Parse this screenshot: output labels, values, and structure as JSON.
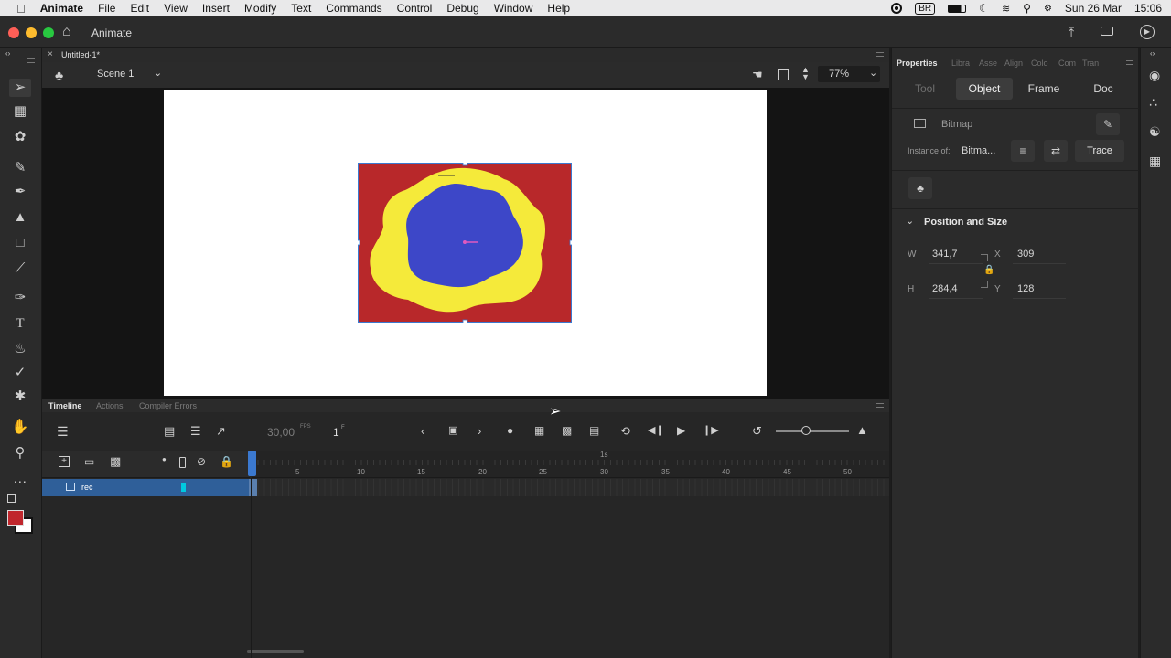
{
  "menubar": {
    "apple": "",
    "items": [
      "Animate",
      "File",
      "Edit",
      "View",
      "Insert",
      "Modify",
      "Text",
      "Commands",
      "Control",
      "Debug",
      "Window",
      "Help"
    ],
    "input_source": "BR",
    "date": "Sun 26 Mar",
    "time": "15:06"
  },
  "titlebar": {
    "app_name": "Animate"
  },
  "document": {
    "tab_name": "Untitled-1*"
  },
  "scene": {
    "name": "Scene 1",
    "zoom": "77%"
  },
  "timeline": {
    "tabs": [
      "Timeline",
      "Actions",
      "Compiler Errors"
    ],
    "fps": "30,00",
    "fps_unit": "FPS",
    "frame": "1",
    "frame_unit": "F",
    "seconds_marker": "1s",
    "frame_ticks": [
      "5",
      "10",
      "15",
      "20",
      "25",
      "30",
      "35",
      "40",
      "45",
      "50"
    ],
    "layers": [
      {
        "name": "rec",
        "color": "#00c8e0"
      }
    ]
  },
  "properties": {
    "panel_tabs": [
      "Properties",
      "Libra",
      "Asse",
      "Align",
      "Colo",
      "Com",
      "Tran"
    ],
    "sub_tabs": [
      "Tool",
      "Object",
      "Frame",
      "Doc"
    ],
    "active_sub_tab": "Object",
    "object_type": "Bitmap",
    "instance_of_label": "Instance of:",
    "instance_of_value": "Bitma...",
    "trace_button": "Trace",
    "section_title": "Position and Size",
    "w_label": "W",
    "w_value": "341,7",
    "h_label": "H",
    "h_value": "284,4",
    "x_label": "X",
    "x_value": "309",
    "y_label": "Y",
    "y_value": "128"
  },
  "colors": {
    "accent": "#3b79d0",
    "stroke_swatch": "#ffffff",
    "fill_swatch": "#c0272d",
    "bitmap_red": "#b8282a",
    "bitmap_yellow": "#f5ea3a",
    "bitmap_blue": "#3d47c8"
  }
}
